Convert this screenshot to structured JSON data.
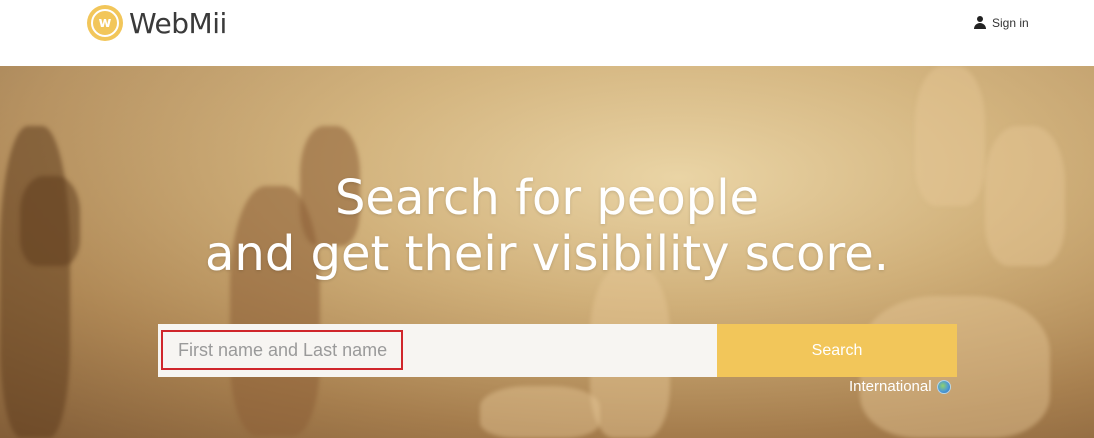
{
  "header": {
    "brand": "WebMii",
    "logo_letter": "w",
    "signin_label": "Sign in",
    "icons": {
      "user": "user-icon",
      "logo": "webmii-logo-icon"
    }
  },
  "hero": {
    "headline_line1": "Search for people",
    "headline_line2": "and get their visibility score."
  },
  "search": {
    "placeholder": "First name and Last name",
    "value": "",
    "button_label": "Search"
  },
  "region": {
    "label": "International",
    "icon": "globe-icon"
  },
  "colors": {
    "accent": "#f2c65a",
    "highlight": "#d0262b",
    "text_dark": "#3a3a3a"
  }
}
